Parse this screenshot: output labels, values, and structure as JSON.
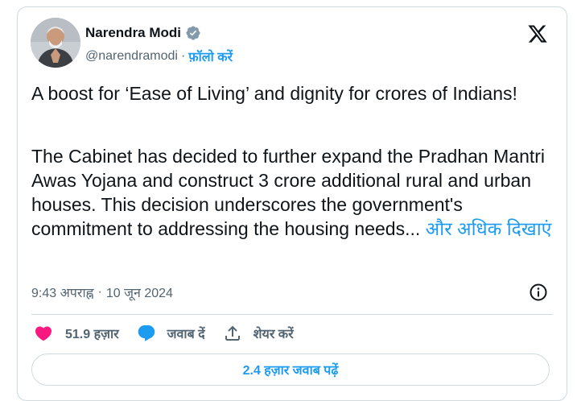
{
  "author": {
    "name": "Narendra Modi",
    "handle": "@narendramodi",
    "separator": "·",
    "follow_label": "फ़ॉलो करें"
  },
  "post": {
    "paragraph1": "A boost for ‘Ease of Living’ and dignity for crores of Indians!",
    "paragraph2": "The Cabinet has decided to further expand the Pradhan Mantri Awas Yojana and construct 3 crore additional rural and urban houses. This decision underscores the government's commitment to addressing the housing needs...",
    "show_more": " और अधिक दिखाएं"
  },
  "meta": {
    "time": "9:43 अपराह्न",
    "separator": "·",
    "date": "10 जून 2024"
  },
  "actions": {
    "likes": "51.9 हज़ार",
    "reply": "जवाब दें",
    "share": "शेयर करें"
  },
  "read_replies": "2.4 हज़ार जवाब पढ़ें",
  "colors": {
    "accent": "#1d9bf0",
    "like": "#f91880",
    "text": "#0f1419",
    "muted": "#536471",
    "border": "#cfd9de"
  },
  "icons": [
    "verified-badge-icon",
    "x-logo-icon",
    "info-icon",
    "heart-icon",
    "reply-bubble-icon",
    "share-icon"
  ]
}
